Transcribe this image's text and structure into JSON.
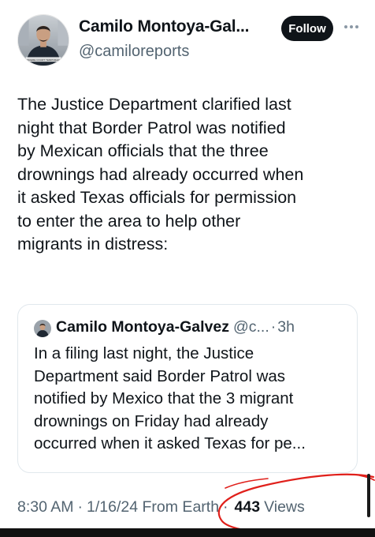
{
  "author": {
    "display_name": "Camilo Montoya-Gal...",
    "handle": "@camiloreports",
    "avatar_icon": "profile-photo",
    "avatar_caption": "SUPREME COURT TEMPORARILY"
  },
  "follow_label": "Follow",
  "more_icon": "ellipsis-icon",
  "tweet_lines": [
    "The Justice Department clarified last",
    "night that Border Patrol was notified",
    "by Mexican officials that the three",
    "drownings had already occurred when",
    "it asked Texas officials for permission",
    "to enter the area to help other",
    "migrants in distress:"
  ],
  "quote": {
    "display_name": "Camilo Montoya-Galvez",
    "handle": "@c...",
    "dot": "·",
    "time": "3h",
    "text_lines": [
      "In a filing last night, the Justice",
      "Department said Border Patrol was",
      "notified by Mexico that the 3 migrant",
      "drownings on Friday had already",
      "occurred when it asked Texas for pe..."
    ]
  },
  "meta": {
    "time": "8:30 AM",
    "sep1": "·",
    "date": "1/16/24 From Earth",
    "sep2": "·",
    "views_count": "443",
    "views_label": "Views"
  },
  "colors": {
    "text": "#0f1419",
    "secondary": "#536471",
    "annotation": "#e0201b",
    "button_bg": "#0f1419"
  }
}
